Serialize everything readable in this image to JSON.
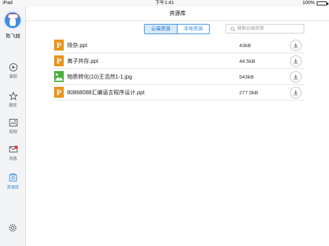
{
  "statusbar": {
    "carrier": "iPad",
    "time": "下午1:41",
    "battery": "100%"
  },
  "sidebar": {
    "username": "陈飞越",
    "items": [
      {
        "label": "课程",
        "icon": "play-circle-icon",
        "active": false
      },
      {
        "label": "题库",
        "icon": "star-icon",
        "active": false
      },
      {
        "label": "视频",
        "icon": "video-icon",
        "active": false
      },
      {
        "label": "消息",
        "icon": "mail-icon",
        "active": false,
        "badge": true
      },
      {
        "label": "资源库",
        "icon": "resource-icon",
        "active": true
      }
    ],
    "settings_icon": "gear-icon"
  },
  "header": {
    "title": "资源库"
  },
  "tabs": [
    {
      "label": "云端资源",
      "active": true
    },
    {
      "label": "本地资源",
      "active": false
    }
  ],
  "search": {
    "placeholder": "搜索云端资源"
  },
  "files": [
    {
      "name": "除杂.ppt",
      "size": "43kB",
      "type": "ppt"
    },
    {
      "name": "离子共存.ppt",
      "size": "44.5kB",
      "type": "ppt"
    },
    {
      "name": "物质转化(10)王浩然1-1.jpg",
      "size": "543kB",
      "type": "jpg"
    },
    {
      "name": "80868088汇编语言程序设计.ppt",
      "size": "277.5kB",
      "type": "ppt"
    }
  ],
  "colors": {
    "accent": "#3a8ee6",
    "ppt": "#e8951d",
    "jpg": "#4cae3f",
    "badge": "#e33333"
  }
}
